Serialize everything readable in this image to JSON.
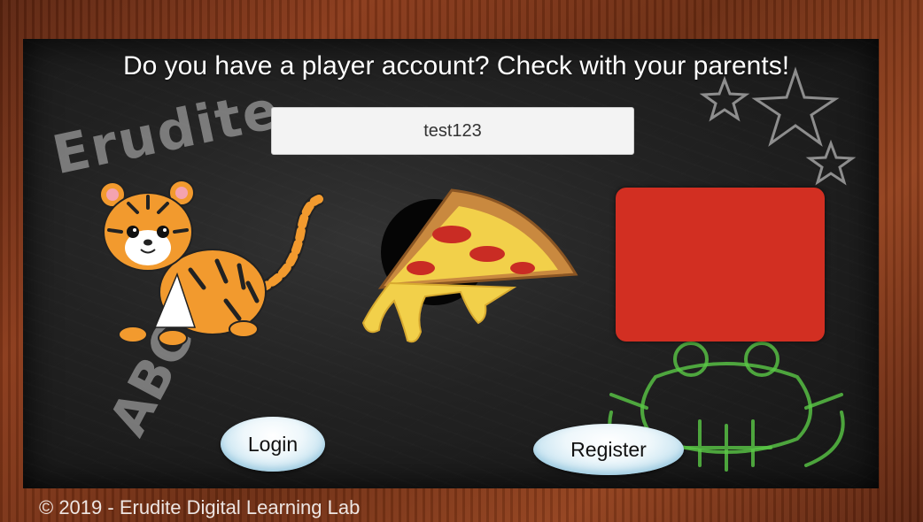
{
  "prompt": {
    "title": "Do you have a player account? Check with your parents!"
  },
  "login_field": {
    "value": "test123"
  },
  "chalk_texts": {
    "logo": "Erudite",
    "letters": "ABC"
  },
  "pictures": [
    {
      "name": "tiger",
      "selected": false
    },
    {
      "name": "pizza-slice",
      "selected": false
    },
    {
      "name": "red-card",
      "color": "#d22f22",
      "selected": false
    }
  ],
  "buttons": {
    "login_label": "Login",
    "register_label": "Register"
  },
  "footer": {
    "copyright": "© 2019 - Erudite Digital Learning Lab"
  },
  "colors": {
    "frame": "#7a3417",
    "chalkboard": "#222222",
    "red_card": "#d22f22",
    "text": "#ffffff"
  }
}
